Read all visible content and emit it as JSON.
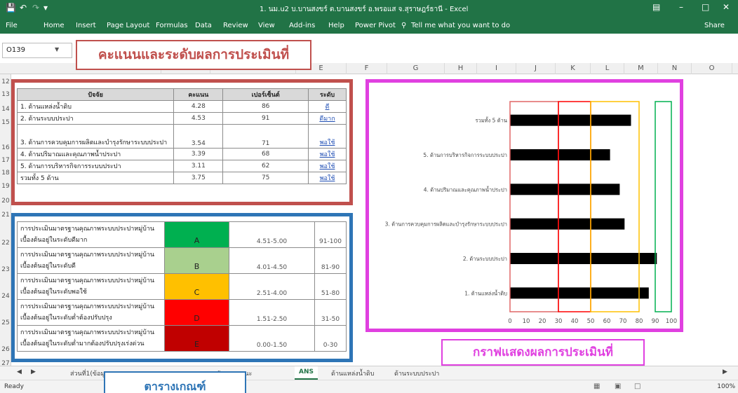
{
  "window": {
    "title": "1. นม.u2 บ.บานสงขร์ ต.บานสงขร์ อ.พรอแส จ.สุราษฎร์ธานี - Excel",
    "menu": [
      "File",
      "Home",
      "Insert",
      "Page Layout",
      "Formulas",
      "Data",
      "Review",
      "View",
      "Add-ins",
      "Help",
      "Power Pivot",
      "Tell me what you want to do",
      "Share"
    ]
  },
  "formula_bar": {
    "name_box": "O139"
  },
  "columns": [
    "A",
    "B",
    "C",
    "E",
    "F",
    "G",
    "H",
    "I",
    "J",
    "K",
    "L",
    "M",
    "N",
    "O"
  ],
  "row_numbers": [
    "12",
    "13",
    "14",
    "15",
    "16",
    "17",
    "18",
    "19",
    "20",
    "21",
    "22",
    "23",
    "24",
    "25",
    "26",
    "27"
  ],
  "score_table": {
    "headers": [
      "ปัจจัย",
      "คะแนน",
      "เปอร์เซ็นต์",
      "ระดับ"
    ],
    "rows": [
      {
        "factor": "1. ด้านแหล่งน้ำดิบ",
        "score": "4.28",
        "percent": "86",
        "level": "ดี"
      },
      {
        "factor": "2. ด้านระบบประปา",
        "score": "4.53",
        "percent": "91",
        "level": "ดีมาก"
      },
      {
        "factor": "3. ด้านการควบคุมการผลิตและบำรุงรักษาระบบประปา",
        "score": "3.54",
        "percent": "71",
        "level": "พอใช้"
      },
      {
        "factor": "4. ด้านปริมาณและคุณภาพน้ำประปา",
        "score": "3.39",
        "percent": "68",
        "level": "พอใช้"
      },
      {
        "factor": "5. ด้านการบริหารกิจการระบบประปา",
        "score": "3.11",
        "percent": "62",
        "level": "พอใช้"
      },
      {
        "factor": "รวมทั้ง 5 ด้าน",
        "score": "3.75",
        "percent": "75",
        "level": "พอใช้"
      }
    ]
  },
  "criteria_table": {
    "rows": [
      {
        "line1": "การประเมินมาตรฐานคุณภาพระบบประปาหมู่บ้าน",
        "line2": "เบื้องต้นอยู่ในระดับดีมาก",
        "grade": "A",
        "range": "4.51-5.00",
        "percent": "91-100",
        "color": "#00b050"
      },
      {
        "line1": "การประเมินมาตรฐานคุณภาพระบบประปาหมู่บ้าน",
        "line2": "เบื้องต้นอยู่ในระดับดี",
        "grade": "B",
        "range": "4.01-4.50",
        "percent": "81-90",
        "color": "#a9d08e"
      },
      {
        "line1": "การประเมินมาตรฐานคุณภาพระบบประปาหมู่บ้าน",
        "line2": "เบื้องต้นอยู่ในระดับพอใช้",
        "grade": "C",
        "range": "2.51-4.00",
        "percent": "51-80",
        "color": "#ffc000"
      },
      {
        "line1": "การประเมินมาตรฐานคุณภาพระบบประปาหมู่บ้าน",
        "line2": "เบื้องต้นอยู่ในระดับต่ำต้องปรับปรุง",
        "grade": "D",
        "range": "1.51-2.50",
        "percent": "31-50",
        "color": "#ff0000"
      },
      {
        "line1": "การประเมินมาตรฐานคุณภาพระบบประปาหมู่บ้าน",
        "line2": "เบื้องต้นอยู่ในระดับต่ำมากต้องปรับปรุงเร่งด่วน",
        "grade": "E",
        "range": "0.00-1.50",
        "percent": "0-30",
        "color": "#c00000"
      }
    ]
  },
  "callouts": {
    "score": "คะแนนและระดับผลการประเมินที่",
    "graph": "กราฟแสดงผลการประเมินที่",
    "criteria": "ตารางเกณฑ์"
  },
  "chart_data": {
    "type": "bar",
    "orientation": "horizontal",
    "categories": [
      "รวมทั้ง 5 ด้าน",
      "5. ด้านการบริหารกิจการระบบประปา",
      "4. ด้านปริมาณและคุณภาพน้ำประปา",
      "3. ด้านการควบคุมการผลิตและบำรุงรักษาระบบประปา",
      "2. ด้านระบบประปา",
      "1. ด้านแหล่งน้ำดิบ"
    ],
    "values": [
      75,
      62,
      68,
      71,
      91,
      86
    ],
    "xlim": [
      0,
      100
    ],
    "xticks": [
      "0",
      "10",
      "20",
      "30",
      "40",
      "50",
      "60",
      "70",
      "80",
      "90",
      "100"
    ],
    "bar_color": "#000000",
    "threshold_bands": [
      {
        "from": 0,
        "to": 30,
        "color": "#e06666"
      },
      {
        "from": 30,
        "to": 50,
        "color": "#ff0000"
      },
      {
        "from": 50,
        "to": 80,
        "color": "#ffc000"
      },
      {
        "from": 90,
        "to": 100,
        "color": "#00b050"
      }
    ]
  },
  "sheet_tabs": [
    "ส่วนที่1(ข้อมูล",
    "...ลัก เสนอแนะ",
    "ANS",
    "ด้านแหล่งน้ำดิบ",
    "ด้านระบบประปา"
  ],
  "status": {
    "left": "Ready",
    "zoom": "100%"
  }
}
